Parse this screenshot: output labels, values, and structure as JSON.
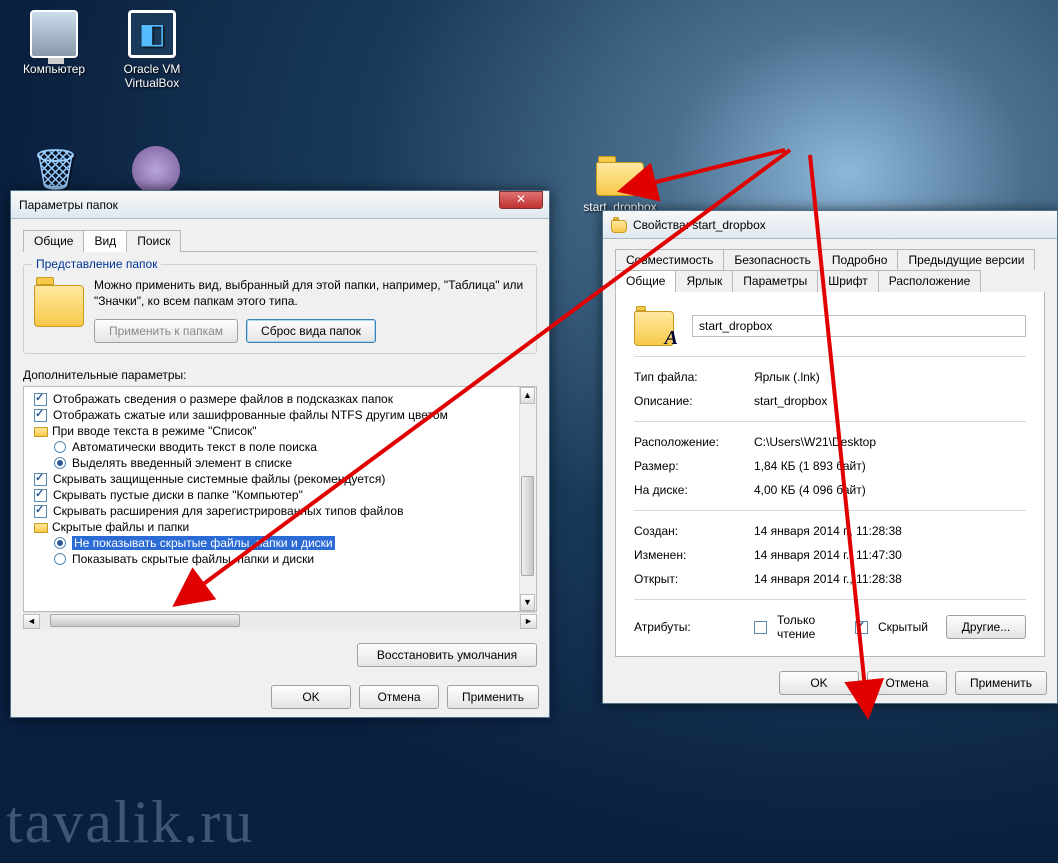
{
  "desktop": {
    "icons": {
      "computer": "Компьютер",
      "virtualbox": "Oracle VM VirtualBox",
      "start_dropbox": "start_dropbox"
    }
  },
  "folder_options": {
    "title": "Параметры папок",
    "tabs": {
      "general": "Общие",
      "view": "Вид",
      "search": "Поиск"
    },
    "groupbox": {
      "legend": "Представление папок",
      "text": "Можно применить вид, выбранный для этой папки, например, \"Таблица\" или \"Значки\", ко всем папкам этого типа.",
      "btn_apply": "Применить к папкам",
      "btn_reset": "Сброс вида папок"
    },
    "advanced_label": "Дополнительные параметры:",
    "items": [
      {
        "kind": "check",
        "indent": 0,
        "checked": true,
        "text": "Отображать сведения о размере файлов в подсказках папок"
      },
      {
        "kind": "check",
        "indent": 0,
        "checked": true,
        "text": "Отображать сжатые или зашифрованные файлы NTFS другим цветом"
      },
      {
        "kind": "folder",
        "indent": 0,
        "text": "При вводе текста в режиме \"Список\""
      },
      {
        "kind": "radio",
        "indent": 1,
        "checked": false,
        "text": "Автоматически вводить текст в поле поиска"
      },
      {
        "kind": "radio",
        "indent": 1,
        "checked": true,
        "text": "Выделять введенный элемент в списке"
      },
      {
        "kind": "check",
        "indent": 0,
        "checked": true,
        "text": "Скрывать защищенные системные файлы (рекомендуется)"
      },
      {
        "kind": "check",
        "indent": 0,
        "checked": true,
        "text": "Скрывать пустые диски в папке \"Компьютер\""
      },
      {
        "kind": "check",
        "indent": 0,
        "checked": true,
        "text": "Скрывать расширения для зарегистрированных типов файлов"
      },
      {
        "kind": "folder",
        "indent": 0,
        "text": "Скрытые файлы и папки"
      },
      {
        "kind": "radio",
        "indent": 1,
        "checked": true,
        "selected": true,
        "text": "Не показывать скрытые файлы, папки и диски"
      },
      {
        "kind": "radio",
        "indent": 1,
        "checked": false,
        "text": "Показывать скрытые файлы, папки и диски"
      }
    ],
    "btn_restore": "Восстановить умолчания",
    "btn_ok": "OK",
    "btn_cancel": "Отмена",
    "btn_apply_main": "Применить"
  },
  "properties": {
    "title": "Свойства: start_dropbox",
    "tabs_row1": [
      "Совместимость",
      "Безопасность",
      "Подробно",
      "Предыдущие версии"
    ],
    "tabs_row2": [
      "Общие",
      "Ярлык",
      "Параметры",
      "Шрифт",
      "Расположение"
    ],
    "active_tab": "Общие",
    "filename": "start_dropbox",
    "fields": {
      "file_type_label": "Тип файла:",
      "file_type": "Ярлык (.lnk)",
      "description_label": "Описание:",
      "description": "start_dropbox",
      "location_label": "Расположение:",
      "location": "C:\\Users\\W21\\Desktop",
      "size_label": "Размер:",
      "size": "1,84 КБ (1 893 байт)",
      "size_on_disk_label": "На диске:",
      "size_on_disk": "4,00 КБ (4 096 байт)",
      "created_label": "Создан:",
      "created": "14 января 2014 г., 11:28:38",
      "modified_label": "Изменен:",
      "modified": "14 января 2014 г., 11:47:30",
      "accessed_label": "Открыт:",
      "accessed": "14 января 2014 г., 11:28:38",
      "attributes_label": "Атрибуты:",
      "readonly_label": "Только чтение",
      "hidden_label": "Скрытый",
      "btn_other": "Другие..."
    },
    "btn_ok": "OK",
    "btn_cancel": "Отмена",
    "btn_apply": "Применить"
  },
  "watermark": "tavalik.ru"
}
